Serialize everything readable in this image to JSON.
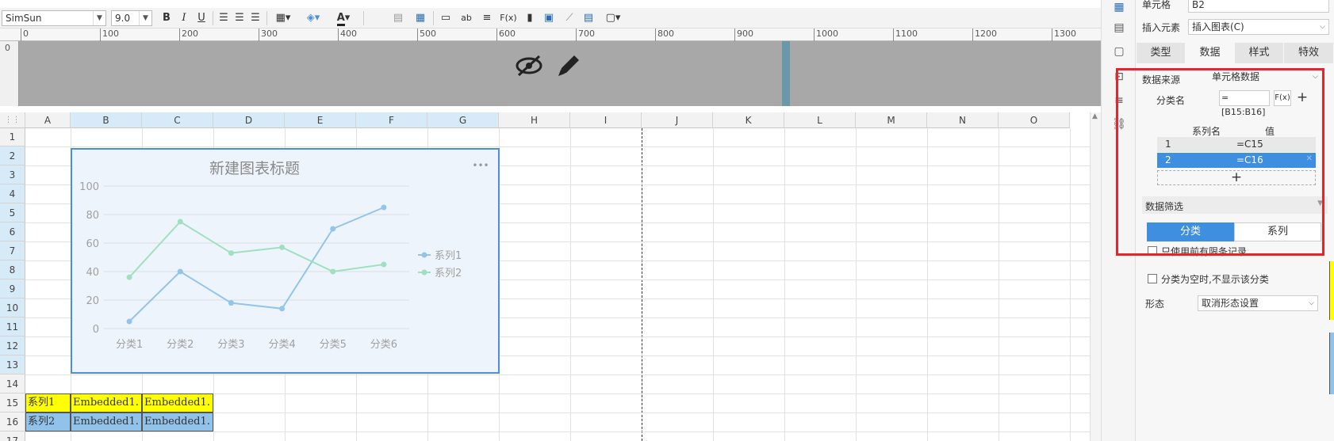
{
  "toolbar": {
    "font_family": "SimSun",
    "font_size": "9.0",
    "bold": "B",
    "italic": "I",
    "underline": "U",
    "function_label": "F(x)",
    "text_ab": "ab"
  },
  "ruler": {
    "ticks": [
      "0",
      "100",
      "200",
      "300",
      "400",
      "500",
      "600",
      "700",
      "800",
      "900",
      "1000",
      "1100",
      "1200",
      "1300"
    ],
    "left_tick": "0"
  },
  "columns": [
    "A",
    "B",
    "C",
    "D",
    "E",
    "F",
    "G",
    "H",
    "I",
    "J",
    "K",
    "L",
    "M",
    "N",
    "O"
  ],
  "rows": [
    "1",
    "2",
    "3",
    "4",
    "5",
    "6",
    "7",
    "8",
    "9",
    "10",
    "11",
    "12",
    "13",
    "14",
    "15",
    "16",
    "17"
  ],
  "cells": {
    "a15": "系列1",
    "b15": "Embedded1.",
    "c15": "Embedded1.",
    "a16": "系列2",
    "b16": "Embedded1.",
    "c16": "Embedded1."
  },
  "chart_data": {
    "type": "line",
    "title": "新建图表标题",
    "categories": [
      "分类1",
      "分类2",
      "分类3",
      "分类4",
      "分类5",
      "分类6"
    ],
    "series": [
      {
        "name": "系列1",
        "values": [
          5,
          40,
          18,
          14,
          70,
          85
        ],
        "color": "#92c5e8"
      },
      {
        "name": "系列2",
        "values": [
          36,
          75,
          53,
          57,
          40,
          45
        ],
        "color": "#9fe0bf"
      }
    ],
    "y_ticks": [
      "0",
      "20",
      "40",
      "60",
      "80",
      "100"
    ],
    "ylim": [
      0,
      100
    ],
    "legend": "right",
    "grid": true,
    "menu_label": "•••"
  },
  "panel": {
    "cell_label": "单元格",
    "cell_value": "B2",
    "insert_label": "插入元素",
    "insert_value": "插入图表(C)",
    "tabs": [
      "类型",
      "数据",
      "样式",
      "特效"
    ],
    "data_source_label": "数据来源",
    "data_source_value": "单元格数据",
    "category_label": "分类名",
    "category_value": "=[B15:B16]",
    "fx_label": "F(x)",
    "add_label": "+",
    "series_header_name": "系列名",
    "series_header_value": "值",
    "series_rows": [
      {
        "name": "1",
        "value": "=C15"
      },
      {
        "name": "2",
        "value": "=C16"
      }
    ],
    "add_series_label": "+",
    "filter_label": "数据筛选",
    "filter_tabs": [
      "分类",
      "系列"
    ],
    "only_top_label": "只使用前有限条记录",
    "hide_empty_label": "分类为空时,不显示该分类",
    "shape_label": "形态",
    "shape_value": "取消形态设置"
  }
}
